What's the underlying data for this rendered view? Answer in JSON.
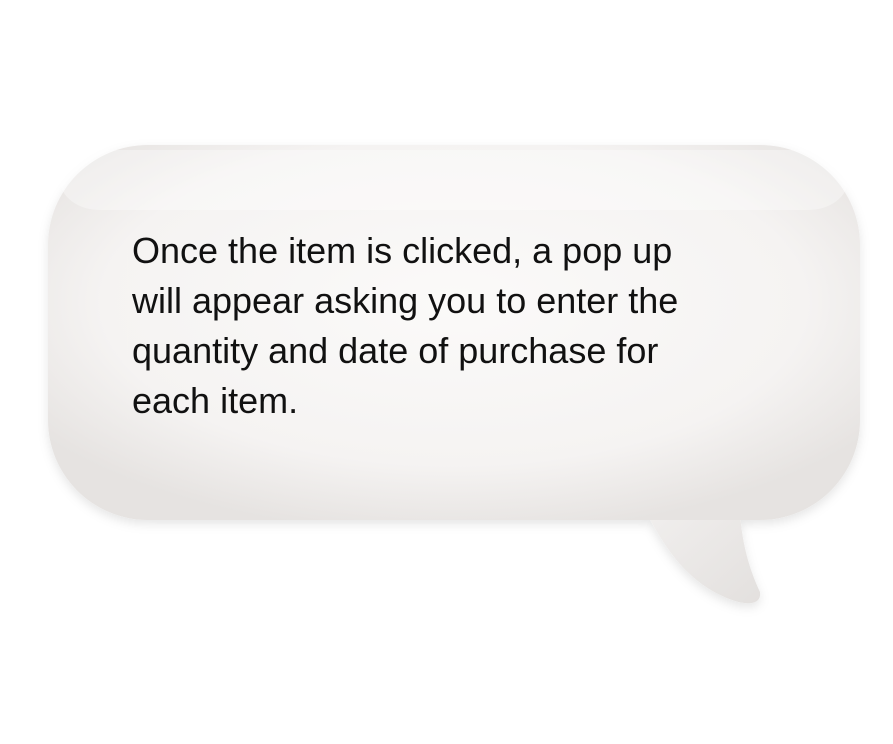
{
  "speech_bubble": {
    "lines": [
      "Once the item is clicked, a pop up",
      "will appear asking you to enter the",
      "quantity and date of purchase for",
      "each item."
    ],
    "colors": {
      "background": "#ffffff",
      "bubble_fill": "#f6f4f3",
      "text": "#111111"
    }
  }
}
